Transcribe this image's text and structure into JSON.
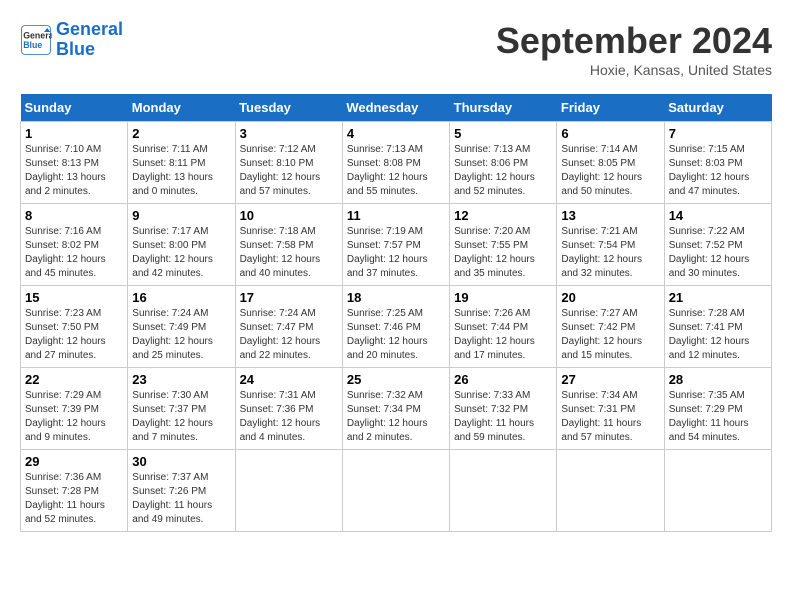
{
  "header": {
    "logo_line1": "General",
    "logo_line2": "Blue",
    "month_title": "September 2024",
    "location": "Hoxie, Kansas, United States"
  },
  "weekdays": [
    "Sunday",
    "Monday",
    "Tuesday",
    "Wednesday",
    "Thursday",
    "Friday",
    "Saturday"
  ],
  "weeks": [
    [
      {
        "day": "1",
        "sunrise": "Sunrise: 7:10 AM",
        "sunset": "Sunset: 8:13 PM",
        "daylight": "Daylight: 13 hours and 2 minutes."
      },
      {
        "day": "2",
        "sunrise": "Sunrise: 7:11 AM",
        "sunset": "Sunset: 8:11 PM",
        "daylight": "Daylight: 13 hours and 0 minutes."
      },
      {
        "day": "3",
        "sunrise": "Sunrise: 7:12 AM",
        "sunset": "Sunset: 8:10 PM",
        "daylight": "Daylight: 12 hours and 57 minutes."
      },
      {
        "day": "4",
        "sunrise": "Sunrise: 7:13 AM",
        "sunset": "Sunset: 8:08 PM",
        "daylight": "Daylight: 12 hours and 55 minutes."
      },
      {
        "day": "5",
        "sunrise": "Sunrise: 7:13 AM",
        "sunset": "Sunset: 8:06 PM",
        "daylight": "Daylight: 12 hours and 52 minutes."
      },
      {
        "day": "6",
        "sunrise": "Sunrise: 7:14 AM",
        "sunset": "Sunset: 8:05 PM",
        "daylight": "Daylight: 12 hours and 50 minutes."
      },
      {
        "day": "7",
        "sunrise": "Sunrise: 7:15 AM",
        "sunset": "Sunset: 8:03 PM",
        "daylight": "Daylight: 12 hours and 47 minutes."
      }
    ],
    [
      {
        "day": "8",
        "sunrise": "Sunrise: 7:16 AM",
        "sunset": "Sunset: 8:02 PM",
        "daylight": "Daylight: 12 hours and 45 minutes."
      },
      {
        "day": "9",
        "sunrise": "Sunrise: 7:17 AM",
        "sunset": "Sunset: 8:00 PM",
        "daylight": "Daylight: 12 hours and 42 minutes."
      },
      {
        "day": "10",
        "sunrise": "Sunrise: 7:18 AM",
        "sunset": "Sunset: 7:58 PM",
        "daylight": "Daylight: 12 hours and 40 minutes."
      },
      {
        "day": "11",
        "sunrise": "Sunrise: 7:19 AM",
        "sunset": "Sunset: 7:57 PM",
        "daylight": "Daylight: 12 hours and 37 minutes."
      },
      {
        "day": "12",
        "sunrise": "Sunrise: 7:20 AM",
        "sunset": "Sunset: 7:55 PM",
        "daylight": "Daylight: 12 hours and 35 minutes."
      },
      {
        "day": "13",
        "sunrise": "Sunrise: 7:21 AM",
        "sunset": "Sunset: 7:54 PM",
        "daylight": "Daylight: 12 hours and 32 minutes."
      },
      {
        "day": "14",
        "sunrise": "Sunrise: 7:22 AM",
        "sunset": "Sunset: 7:52 PM",
        "daylight": "Daylight: 12 hours and 30 minutes."
      }
    ],
    [
      {
        "day": "15",
        "sunrise": "Sunrise: 7:23 AM",
        "sunset": "Sunset: 7:50 PM",
        "daylight": "Daylight: 12 hours and 27 minutes."
      },
      {
        "day": "16",
        "sunrise": "Sunrise: 7:24 AM",
        "sunset": "Sunset: 7:49 PM",
        "daylight": "Daylight: 12 hours and 25 minutes."
      },
      {
        "day": "17",
        "sunrise": "Sunrise: 7:24 AM",
        "sunset": "Sunset: 7:47 PM",
        "daylight": "Daylight: 12 hours and 22 minutes."
      },
      {
        "day": "18",
        "sunrise": "Sunrise: 7:25 AM",
        "sunset": "Sunset: 7:46 PM",
        "daylight": "Daylight: 12 hours and 20 minutes."
      },
      {
        "day": "19",
        "sunrise": "Sunrise: 7:26 AM",
        "sunset": "Sunset: 7:44 PM",
        "daylight": "Daylight: 12 hours and 17 minutes."
      },
      {
        "day": "20",
        "sunrise": "Sunrise: 7:27 AM",
        "sunset": "Sunset: 7:42 PM",
        "daylight": "Daylight: 12 hours and 15 minutes."
      },
      {
        "day": "21",
        "sunrise": "Sunrise: 7:28 AM",
        "sunset": "Sunset: 7:41 PM",
        "daylight": "Daylight: 12 hours and 12 minutes."
      }
    ],
    [
      {
        "day": "22",
        "sunrise": "Sunrise: 7:29 AM",
        "sunset": "Sunset: 7:39 PM",
        "daylight": "Daylight: 12 hours and 9 minutes."
      },
      {
        "day": "23",
        "sunrise": "Sunrise: 7:30 AM",
        "sunset": "Sunset: 7:37 PM",
        "daylight": "Daylight: 12 hours and 7 minutes."
      },
      {
        "day": "24",
        "sunrise": "Sunrise: 7:31 AM",
        "sunset": "Sunset: 7:36 PM",
        "daylight": "Daylight: 12 hours and 4 minutes."
      },
      {
        "day": "25",
        "sunrise": "Sunrise: 7:32 AM",
        "sunset": "Sunset: 7:34 PM",
        "daylight": "Daylight: 12 hours and 2 minutes."
      },
      {
        "day": "26",
        "sunrise": "Sunrise: 7:33 AM",
        "sunset": "Sunset: 7:32 PM",
        "daylight": "Daylight: 11 hours and 59 minutes."
      },
      {
        "day": "27",
        "sunrise": "Sunrise: 7:34 AM",
        "sunset": "Sunset: 7:31 PM",
        "daylight": "Daylight: 11 hours and 57 minutes."
      },
      {
        "day": "28",
        "sunrise": "Sunrise: 7:35 AM",
        "sunset": "Sunset: 7:29 PM",
        "daylight": "Daylight: 11 hours and 54 minutes."
      }
    ],
    [
      {
        "day": "29",
        "sunrise": "Sunrise: 7:36 AM",
        "sunset": "Sunset: 7:28 PM",
        "daylight": "Daylight: 11 hours and 52 minutes."
      },
      {
        "day": "30",
        "sunrise": "Sunrise: 7:37 AM",
        "sunset": "Sunset: 7:26 PM",
        "daylight": "Daylight: 11 hours and 49 minutes."
      },
      null,
      null,
      null,
      null,
      null
    ]
  ]
}
